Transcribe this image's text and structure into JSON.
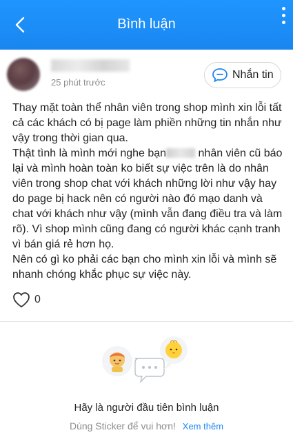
{
  "header": {
    "title": "Bình luận",
    "back_icon": "chevron-left-icon",
    "more_icon": "more-vertical-icon",
    "color": "#1a8cf6"
  },
  "post": {
    "time": "25 phút trước",
    "message_button": "Nhắn tin",
    "message_icon": "chat-bubble-icon",
    "paragraphs": [
      "Thay mặt toàn thể nhân viên trong shop mình xin lỗi tất cả các khách có bị page làm phiền những tin nhắn như vậy trong thời gian qua.",
      "Thật tình là mình mới nghe bạn",
      "nhân viên cũ báo lại và mình hoàn toàn ko biết sự việc trên là do nhân viên trong shop chat với khách những lời như vậy hay do page bị hack nên có người nào đó mạo danh và chat với khách như vậy (mình vẫn đang điều tra và làm rõ). Vì shop mình cũng đang có người khác cạnh tranh vì bán giá rẻ hơn họ.",
      "Nên có gì ko phải các bạn cho mình xin lỗi và mình sẽ nhanh chóng khắc phục sự việc này."
    ],
    "like_count": "0",
    "like_icon": "heart-outline-icon"
  },
  "empty_state": {
    "title": "Hãy là người đầu tiên bình luận",
    "hint": "Dùng Sticker để vui hơn!",
    "see_more": "Xem thêm",
    "link_color": "#1a86f0"
  }
}
